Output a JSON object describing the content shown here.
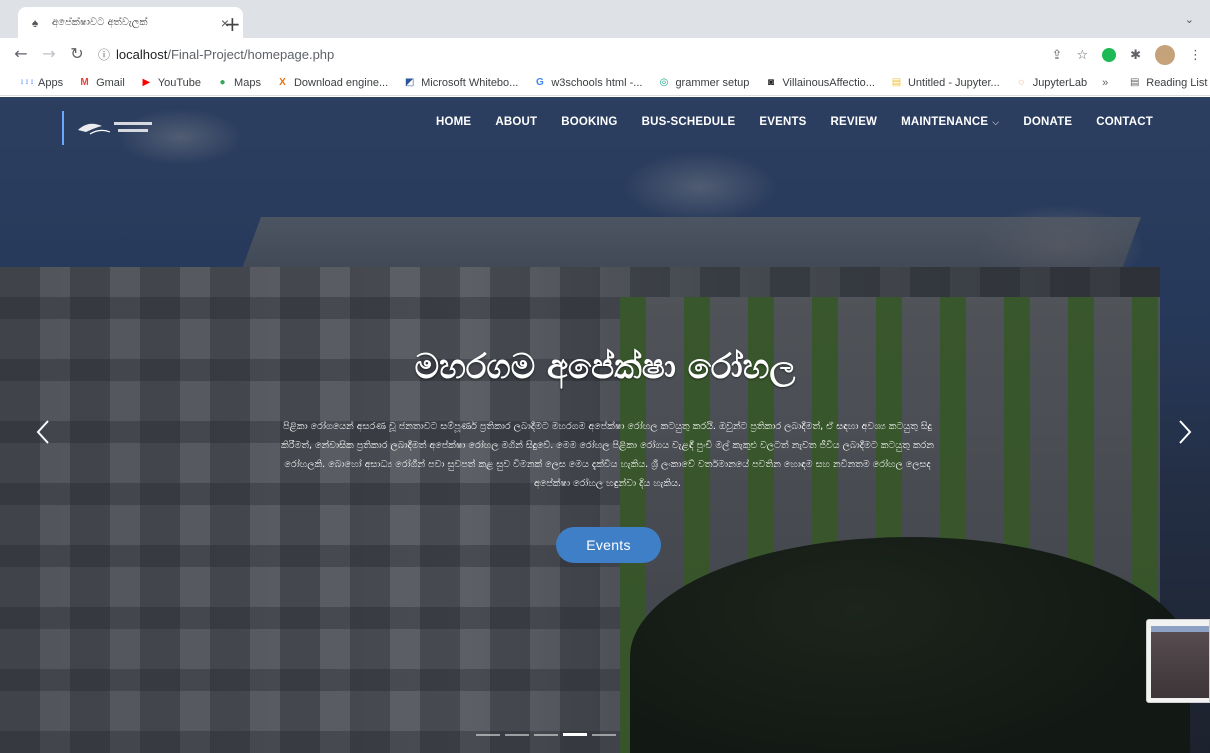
{
  "browser": {
    "tab_title": "අපේක්ෂාවට අත්වැලක්",
    "tab_close": "×",
    "new_tab": "+",
    "tab_menu": "⌄",
    "url_host": "localhost",
    "url_path": "/Final-Project/homepage.php",
    "bookmarks": [
      {
        "label": "Apps",
        "icon": "apps-grid-icon",
        "color": "#4285f4"
      },
      {
        "label": "Gmail",
        "icon": "gmail-icon",
        "color": "#ea4335"
      },
      {
        "label": "YouTube",
        "icon": "youtube-icon",
        "color": "#ff0000"
      },
      {
        "label": "Maps",
        "icon": "maps-pin-icon",
        "color": "#34a853"
      },
      {
        "label": "Download engine...",
        "icon": "x-icon",
        "color": "#e8710a"
      },
      {
        "label": "Microsoft Whitebo...",
        "icon": "whiteboard-icon",
        "color": "#2b579a"
      },
      {
        "label": "w3schools html -...",
        "icon": "google-g-icon",
        "color": "#4285f4"
      },
      {
        "label": "grammer setup",
        "icon": "chatgpt-icon",
        "color": "#10a37f"
      },
      {
        "label": "VillainousAffectio...",
        "icon": "replit-icon",
        "color": "#1e1e1e"
      },
      {
        "label": "Untitled - Jupyter...",
        "icon": "notebook-icon",
        "color": "#f1c232"
      },
      {
        "label": "JupyterLab",
        "icon": "jupyter-icon",
        "color": "#f37626"
      }
    ],
    "bookmarks_overflow": "»",
    "reading_list": "Reading List"
  },
  "site": {
    "nav": [
      {
        "label": "HOME"
      },
      {
        "label": "ABOUT"
      },
      {
        "label": "BOOKING"
      },
      {
        "label": "BUS-SCHEDULE"
      },
      {
        "label": "EVENTS"
      },
      {
        "label": "REVIEW"
      },
      {
        "label": "MAINTENANCE",
        "dropdown": true
      },
      {
        "label": "DONATE"
      },
      {
        "label": "CONTACT"
      }
    ],
    "hero": {
      "title": "මහරගම අපේක්ෂා රෝහල",
      "description": "පිළිකා රෝගයෙන් අසරණ වූ ජනතාවට සම්පූර්ණ ප්‍රතිකාර ලබාදීමට මහරගම අපේක්ෂා රෝහල කටයුතු කරයි. ඔවුන්ට ප්‍රතිකාර ලබාදීමත්, ඒ සඳහා අවශ්‍ය කටයුතු සිදු කිරීමත්, නේවාසික ප්‍රතිකාර ලබාදීමත් අපේක්ෂා රෝහල මගින් සිදුවේ. මෙම රෝහල පිළිකා රෝගය වැළඳී පුංචි මල් කැකුළු වලටත් නැවත ජීවිය ලබාදීමට කටයුතු කරන රෝහලකි. බොහෝ අසාධ්‍ය රෝගීන් පවා සුවපත් කළ සුව විමනක් ලෙස මෙය දැක්විය හැකිය. ශ්‍රී ලංකාවේ වර්තමානයේ පවතින හොඳම සහ නවීනතම රෝහල ලෙසද අපේක්ෂා රෝහල හඳුන්වා දිය හැකිය.",
      "button": "Events"
    },
    "slider": {
      "count": 5,
      "active_index": 3
    },
    "accent_color": "#3f7fc7"
  }
}
